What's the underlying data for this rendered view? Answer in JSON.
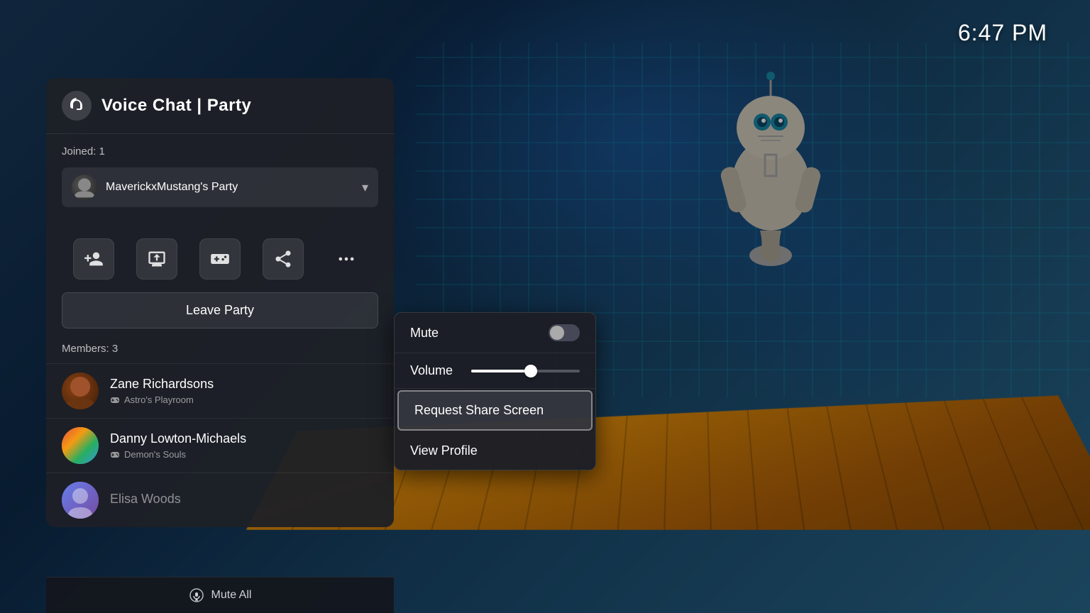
{
  "time": "6:47 PM",
  "panel": {
    "title": "Voice Chat | Party",
    "joined_label": "Joined: 1",
    "party_name": "MaverickxMustang's Party",
    "leave_button": "Leave Party",
    "members_label": "Members: 3",
    "mute_all_label": "Mute All"
  },
  "action_buttons": [
    {
      "name": "add-friend",
      "label": "Add Friend"
    },
    {
      "name": "screen-share",
      "label": "Share Screen"
    },
    {
      "name": "game-share",
      "label": "Game Share"
    },
    {
      "name": "share-play",
      "label": "Share Play"
    },
    {
      "name": "more",
      "label": "More"
    }
  ],
  "members": [
    {
      "name": "Zane Richardsons",
      "game": "Astro's Playroom",
      "avatar_class": "avatar-zane",
      "faded": false
    },
    {
      "name": "Danny Lowton-Michaels",
      "game": "Demon's Souls",
      "avatar_class": "avatar-danny",
      "faded": false
    },
    {
      "name": "Elisa Woods",
      "game": "",
      "avatar_class": "avatar-elisa",
      "faded": true
    }
  ],
  "context_menu": {
    "mute_label": "Mute",
    "volume_label": "Volume",
    "request_share_screen": "Request Share Screen",
    "view_profile": "View Profile"
  }
}
